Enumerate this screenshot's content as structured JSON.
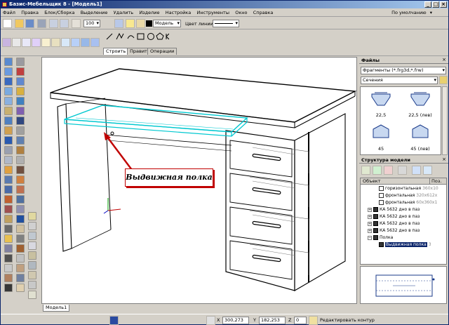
{
  "window": {
    "title": "Базис-Мебельщик 8 - [Модель1]"
  },
  "menu": {
    "items": [
      "Файл",
      "Правка",
      "Блок/Сборка",
      "Выделение",
      "Удалить",
      "Изделие",
      "Настройка",
      "Инструменты",
      "Окно",
      "Справка"
    ],
    "right_label": "По умолчанию"
  },
  "toolbar": {
    "line_width_value": "100",
    "layer_value": "Модель",
    "line_color_label": "Цвет линии"
  },
  "construct_tabs": [
    "Строить",
    "Править",
    "Операции"
  ],
  "canvas": {
    "callout_label": "Выдвижная полка",
    "doc_tab": "Модель1",
    "accent_color": "#00c8d0",
    "callout_border": "#c00000"
  },
  "files_panel": {
    "title": "Файлы",
    "filter_value": "Фрагменты (*.frg3d,*.frw)",
    "folder_value": "Сечения",
    "thumbnails": [
      {
        "label": "22,5"
      },
      {
        "label": "22,5 (лев)"
      },
      {
        "label": "45"
      },
      {
        "label": "45 (лев)"
      }
    ]
  },
  "structure_panel": {
    "title": "Структура модели",
    "col_object": "Объект",
    "col_pos": "Поз.",
    "rows": [
      {
        "name": "горизонтальная",
        "dim": "360x10",
        "indent": 2,
        "hollow": true,
        "expander": "",
        "selected": false
      },
      {
        "name": "фронтальная",
        "dim": "320x612x",
        "indent": 2,
        "hollow": true,
        "expander": "",
        "selected": false
      },
      {
        "name": "фронтальная",
        "dim": "60x360x1",
        "indent": 2,
        "hollow": true,
        "expander": "",
        "selected": false
      },
      {
        "name": "КА 5632 дно в паз",
        "dim": "",
        "indent": 1,
        "hollow": false,
        "expander": "+",
        "selected": false
      },
      {
        "name": "КА 5632 дно в паз",
        "dim": "",
        "indent": 1,
        "hollow": false,
        "expander": "+",
        "selected": false
      },
      {
        "name": "КА 5632 дно в паз",
        "dim": "",
        "indent": 1,
        "hollow": false,
        "expander": "+",
        "selected": false
      },
      {
        "name": "КА 5632 дно в паз",
        "dim": "",
        "indent": 1,
        "hollow": false,
        "expander": "+",
        "selected": false
      },
      {
        "name": "Полка",
        "dim": "",
        "indent": 1,
        "hollow": false,
        "expander": "−",
        "selected": false
      },
      {
        "name": "Выдвижная полка",
        "dim": "3",
        "indent": 2,
        "hollow": false,
        "expander": "",
        "selected": true
      }
    ]
  },
  "status": {
    "x_label": "X",
    "x_value": "300,273",
    "y_label": "Y",
    "y_value": "182,253",
    "z_label": "Z",
    "z_value": "0",
    "mode_label": "Редактировать контур"
  }
}
